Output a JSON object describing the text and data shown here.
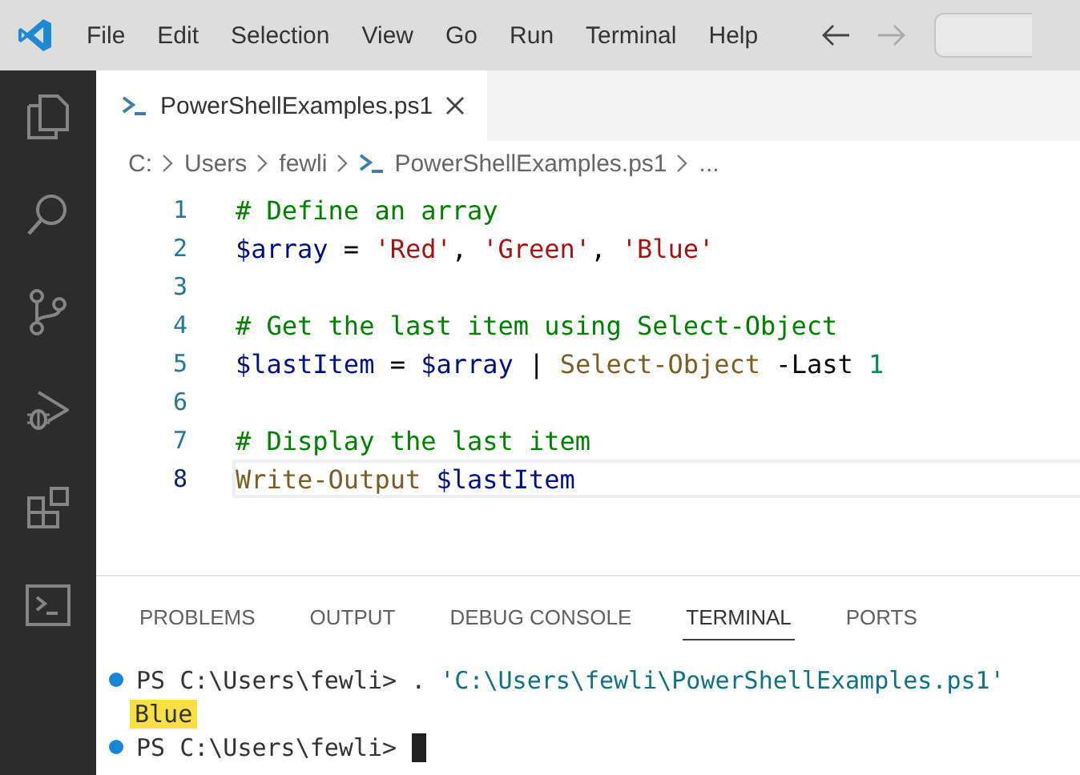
{
  "menu_bar": {
    "items": [
      "File",
      "Edit",
      "Selection",
      "View",
      "Go",
      "Run",
      "Terminal",
      "Help"
    ]
  },
  "activity_bar": {
    "items": [
      {
        "kind": "files",
        "selected": false
      },
      {
        "kind": "search",
        "selected": false
      },
      {
        "kind": "source-control",
        "selected": false
      },
      {
        "kind": "run-debug",
        "selected": false
      },
      {
        "kind": "extensions",
        "selected": false
      },
      {
        "kind": "terminal",
        "selected": false
      }
    ]
  },
  "tabs": [
    {
      "label": "PowerShellExamples.ps1",
      "selected": true
    }
  ],
  "breadcrumb": [
    "C:",
    "Users",
    "fewli",
    "PowerShellExamples.ps1",
    "..."
  ],
  "editor": {
    "lines": [
      {
        "number": "1",
        "current": false,
        "tokens": [
          {
            "text": "# Define an array",
            "kind": "comment"
          }
        ]
      },
      {
        "number": "2",
        "current": false,
        "tokens": [
          {
            "text": "$array",
            "kind": "variable"
          },
          {
            "text": " = ",
            "kind": "plain"
          },
          {
            "text": "'Red'",
            "kind": "string"
          },
          {
            "text": ", ",
            "kind": "plain"
          },
          {
            "text": "'Green'",
            "kind": "string"
          },
          {
            "text": ", ",
            "kind": "plain"
          },
          {
            "text": "'Blue'",
            "kind": "string"
          }
        ]
      },
      {
        "number": "3",
        "current": false
      },
      {
        "number": "4",
        "current": false,
        "tokens": [
          {
            "text": "# Get the last item using Select-Object",
            "kind": "comment"
          }
        ]
      },
      {
        "number": "5",
        "current": false,
        "tokens": [
          {
            "text": "$lastItem",
            "kind": "variable"
          },
          {
            "text": " = ",
            "kind": "plain"
          },
          {
            "text": "$array",
            "kind": "variable"
          },
          {
            "text": " | ",
            "kind": "plain"
          },
          {
            "text": "Select-Object",
            "kind": "command"
          },
          {
            "text": " -Last ",
            "kind": "plain"
          },
          {
            "text": "1",
            "kind": "number"
          }
        ]
      },
      {
        "number": "6",
        "current": false
      },
      {
        "number": "7",
        "current": false,
        "tokens": [
          {
            "text": "# Display the last item",
            "kind": "comment"
          }
        ]
      },
      {
        "number": "8",
        "current": true,
        "tokens": [
          {
            "text": "Write-Output ",
            "kind": "command"
          },
          {
            "text": "$lastItem",
            "kind": "variable"
          }
        ]
      }
    ]
  },
  "panel": {
    "tabs": [
      {
        "label": "PROBLEMS",
        "selected": false
      },
      {
        "label": "OUTPUT",
        "selected": false
      },
      {
        "label": "DEBUG CONSOLE",
        "selected": false
      },
      {
        "label": "TERMINAL",
        "selected": true
      },
      {
        "label": "PORTS",
        "selected": false
      }
    ],
    "terminal": [
      {
        "kind": "prompt",
        "cursor": false,
        "tokens": [
          {
            "text": "PS C:\\Users\\fewli> ",
            "kind": "plain"
          },
          {
            "text": ". ",
            "kind": "plain"
          },
          {
            "text": "'C:\\Users\\fewli\\PowerShellExamples.ps1'",
            "kind": "string"
          }
        ]
      },
      {
        "kind": "output",
        "cursor": false,
        "tokens": [
          {
            "text": "Blue",
            "kind": "highlight"
          }
        ]
      },
      {
        "kind": "prompt",
        "cursor": true,
        "tokens": [
          {
            "text": "PS C:\\Users\\fewli> ",
            "kind": "plain"
          }
        ]
      }
    ]
  }
}
